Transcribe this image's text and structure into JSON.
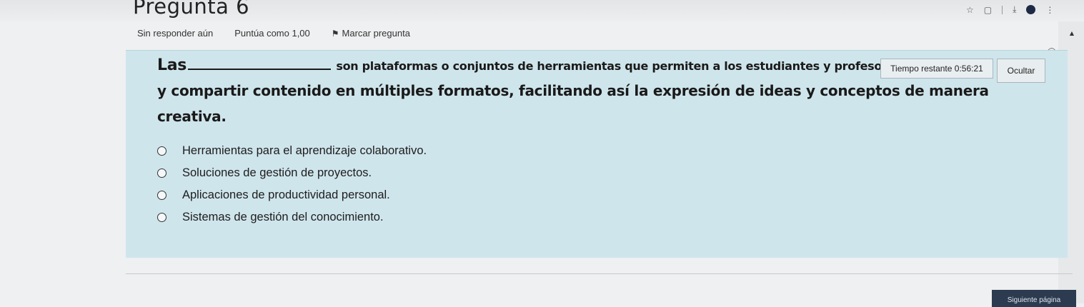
{
  "question": {
    "title": "Pregunta 6",
    "status": "Sin responder aún",
    "score": "Puntúa como 1,00",
    "flag_label": "Marcar pregunta",
    "text_lead": "Las",
    "text_rest_line1": "son plataformas o conjuntos de herramientas que permiten a los estudiantes y profesores crear, editar",
    "text_line2": "y compartir contenido en múltiples formatos, facilitando así la expresión de ideas y conceptos de manera creativa.",
    "options": [
      "Herramientas para el aprendizaje colaborativo.",
      "Soluciones de gestión de proyectos.",
      "Aplicaciones de productividad personal.",
      "Sistemas de gestión del conocimiento."
    ]
  },
  "timer": {
    "label": "Tiempo restante",
    "value": "0:56:21",
    "hide_label": "Ocultar"
  },
  "navigation": {
    "next_label": "Siguiente página"
  },
  "icons": {
    "flag": "flag-icon",
    "star": "star-icon",
    "download": "download-icon",
    "extension": "extension-icon",
    "menu": "kebab-menu-icon"
  }
}
